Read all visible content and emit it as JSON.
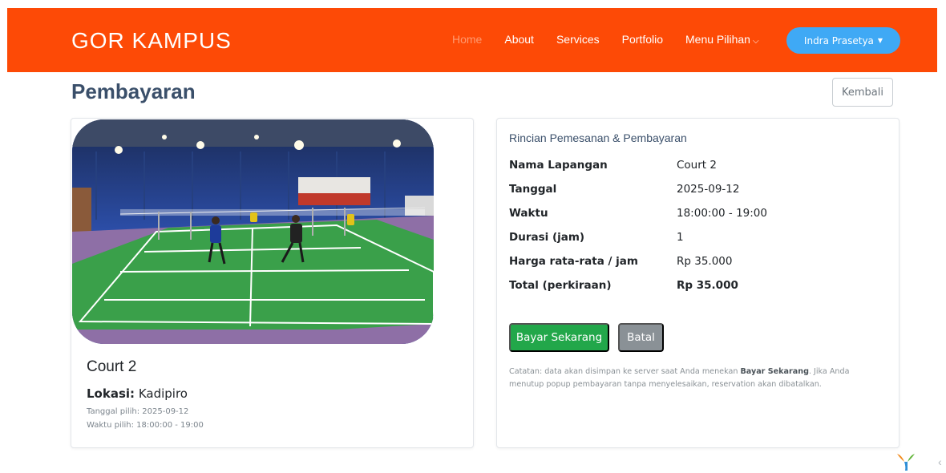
{
  "navbar": {
    "brand": "GOR KAMPUS",
    "links": [
      {
        "label": "Home",
        "active": true
      },
      {
        "label": "About"
      },
      {
        "label": "Services"
      },
      {
        "label": "Portfolio"
      },
      {
        "label": "Menu Pilihan"
      }
    ],
    "menu_caret": "⌵",
    "user": {
      "label": "Indra Prasetya",
      "caret": "▼"
    }
  },
  "page": {
    "title": "Pembayaran",
    "back_label": "Kembali"
  },
  "court": {
    "name": "Court 2",
    "location_label": "Lokasi:",
    "location_value": "Kadipiro",
    "date_note": "Tanggal pilih: 2025-09-12",
    "time_note": "Waktu pilih: 18:00:00 - 19:00"
  },
  "details": {
    "title": "Rincian Pemesanan & Pembayaran",
    "rows": [
      {
        "label": "Nama Lapangan",
        "value": "Court 2"
      },
      {
        "label": "Tanggal",
        "value": "2025-09-12"
      },
      {
        "label": "Waktu",
        "value": "18:00:00 - 19:00"
      },
      {
        "label": "Durasi (jam)",
        "value": "1"
      },
      {
        "label": "Harga rata-rata / jam",
        "value": "Rp 35.000"
      },
      {
        "label": "Total (perkiraan)",
        "value": "Rp 35.000"
      }
    ],
    "pay_label": "Bayar Sekarang",
    "cancel_label": "Batal",
    "note_prefix": "Catatan: data akan disimpan ke server saat Anda menekan ",
    "note_bold": "Bayar Sekarang",
    "note_suffix": ". Jika Anda menutup popup pembayaran tanpa menyelesaikan, reservation akan dibatalkan."
  },
  "corner": {
    "chevron": "‹"
  },
  "colors": {
    "navbar": "#fd4a06",
    "user_button": "#3fa9f5",
    "pay_button": "#22a74a",
    "cancel_button": "#8a9196",
    "court_floor": "#3aa04a"
  }
}
